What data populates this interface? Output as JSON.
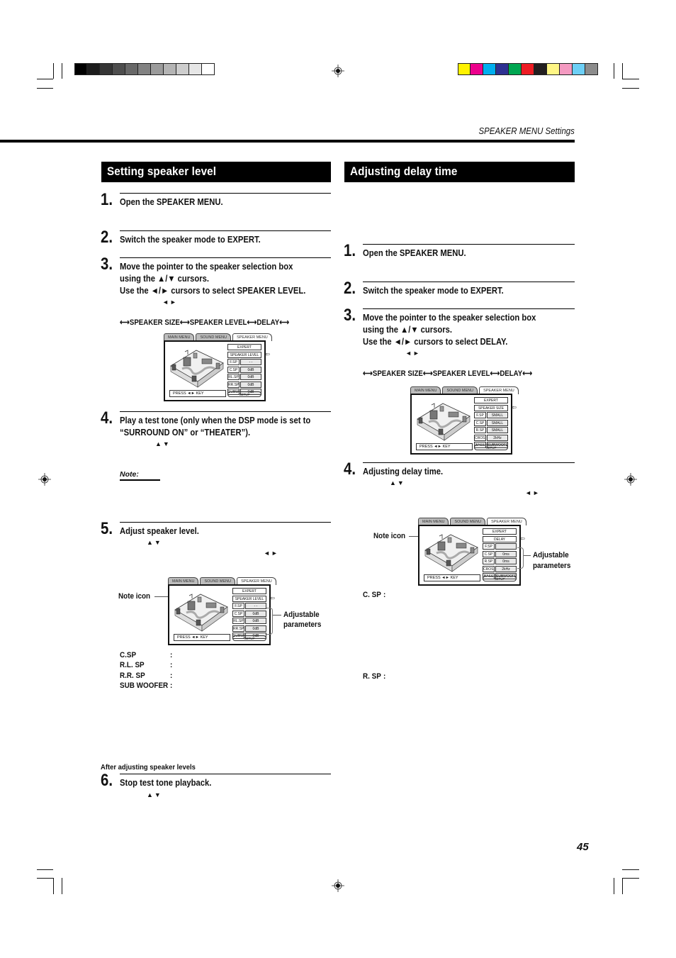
{
  "print_marks": {
    "gray_swatches": [
      "#000000",
      "#1c1c1c",
      "#353535",
      "#4e4e4e",
      "#686868",
      "#828282",
      "#9b9b9b",
      "#b4b4b4",
      "#cdcdcd",
      "#e6e6e6",
      "#ffffff"
    ],
    "color_swatches": [
      "#fff200",
      "#ec008c",
      "#00aeef",
      "#2e3192",
      "#00a651",
      "#ed1c24",
      "#231f20",
      "#fff685",
      "#f49ac1",
      "#6dcff6",
      "#8c8c8c"
    ]
  },
  "header": {
    "section_label": "SPEAKER MENU Settings"
  },
  "left": {
    "title": "Setting speaker level",
    "steps": [
      {
        "num": "1.",
        "text": "Open the SPEAKER MENU."
      },
      {
        "num": "2.",
        "text": "Switch the speaker mode to EXPERT."
      },
      {
        "num": "3.",
        "lines": [
          "Move the pointer to the speaker selection box",
          "using the ▲/▼ cursors.",
          "Use the ◄/► cursors to select SPEAKER LEVEL."
        ],
        "arrows": "◄►"
      },
      {
        "num": "4.",
        "lines": [
          "Play a test tone (only when the DSP mode is set to",
          "“SURROUND ON” or “THEATER”)."
        ],
        "arrows": "▲▼"
      },
      {
        "num": "5.",
        "text": "Adjust speaker level.",
        "arrows_ud": "▲▼",
        "arrows_lr": "◄►"
      },
      {
        "num": "6.",
        "text": "Stop test tone playback.",
        "arrows": "▲▼"
      }
    ],
    "sequence": "⟷SPEAKER SIZE⟷SPEAKER LEVEL⟷DELAY⟷",
    "note_label": "Note:",
    "note_icon_label": "Note icon",
    "adjustable_label": [
      "Adjustable",
      "parameters"
    ],
    "params": [
      {
        "name": "C.SP",
        "sep": ":"
      },
      {
        "name": "R.L. SP",
        "sep": ":"
      },
      {
        "name": "R.R. SP",
        "sep": ":"
      },
      {
        "name": "SUB WOOFER",
        "sep": ":"
      }
    ],
    "after_label": "After adjusting speaker levels",
    "osd1": {
      "tabs": [
        "MAIN MENU",
        "SOUND MENU",
        "SPEAKER MENU"
      ],
      "mode": "EXPERT",
      "selection": "SPEAKER LEVEL",
      "rows": [
        {
          "label": "F.SP",
          "value": "- -"
        },
        {
          "label": "C.SP",
          "value": "0dB"
        },
        {
          "label": "RL.SP",
          "value": "0dB"
        },
        {
          "label": "RR.SP",
          "value": "0dB"
        },
        {
          "label": "SUBWOOFER",
          "value": "0dB"
        }
      ],
      "press": "PRESS ◄► KEY",
      "setup": "SETUP"
    },
    "osd2": {
      "tabs": [
        "MAIN MENU",
        "SOUND MENU",
        "SPEAKER MENU"
      ],
      "mode": "EXPERT",
      "selection": "SPEAKER LEVEL",
      "rows": [
        {
          "label": "F.SP",
          "value": "- -"
        },
        {
          "label": "C.SP",
          "value": "0dB"
        },
        {
          "label": "RL.SP",
          "value": "0dB"
        },
        {
          "label": "RR.SP",
          "value": "0dB"
        },
        {
          "label": "SUBWOOFER",
          "value": "0dB"
        }
      ],
      "press": "PRESS ◄► KEY",
      "setup": "SETUP"
    }
  },
  "right": {
    "title": "Adjusting delay time",
    "steps": [
      {
        "num": "1.",
        "text": "Open the SPEAKER MENU."
      },
      {
        "num": "2.",
        "text": "Switch the speaker mode to EXPERT."
      },
      {
        "num": "3.",
        "lines": [
          "Move the pointer to the speaker selection box",
          "using the ▲/▼ cursors.",
          "Use the ◄/► cursors to select DELAY."
        ],
        "arrows": "◄►"
      },
      {
        "num": "4.",
        "text": "Adjusting delay time.",
        "arrows_ud": "▲▼",
        "arrows_lr": "◄►"
      }
    ],
    "sequence": "⟷SPEAKER SIZE⟷SPEAKER LEVEL⟷DELAY⟷",
    "note_icon_label": "Note icon",
    "adjustable_label": [
      "Adjustable",
      "parameters"
    ],
    "params": [
      {
        "name": "C. SP",
        "sep": ":"
      },
      {
        "name": "R. SP",
        "sep": ":"
      }
    ],
    "osd1": {
      "tabs": [
        "MAIN MENU",
        "SOUND MENU",
        "SPEAKER MENU"
      ],
      "mode": "EXPERT",
      "selection": "SPEAKER SIZE",
      "rows": [
        {
          "label": "F.SP",
          "value": "SMALL"
        },
        {
          "label": "C.SP",
          "value": "SMALL"
        },
        {
          "label": "R.SP",
          "value": "SMALL"
        },
        {
          "label": "CROSSOVER",
          "value": "2kHz"
        },
        {
          "label": "BASS",
          "value": "SUBWOOFER"
        }
      ],
      "press": "PRESS ◄► KEY",
      "setup": "SETUP"
    },
    "osd2": {
      "tabs": [
        "MAIN MENU",
        "SOUND MENU",
        "SPEAKER MENU"
      ],
      "mode": "EXPERT",
      "selection": "DELAY",
      "rows": [
        {
          "label": "F.SP",
          "value": ""
        },
        {
          "label": "C.SP",
          "value": "0ms"
        },
        {
          "label": "R.SP",
          "value": "0ms"
        },
        {
          "label": "CROSSOVER",
          "value": "2kHz"
        },
        {
          "label": "BASS",
          "value": "SUBWOOFER"
        }
      ],
      "press": "PRESS ◄► KEY",
      "setup": "SETUP"
    }
  },
  "footer": {
    "page_number": "45"
  }
}
